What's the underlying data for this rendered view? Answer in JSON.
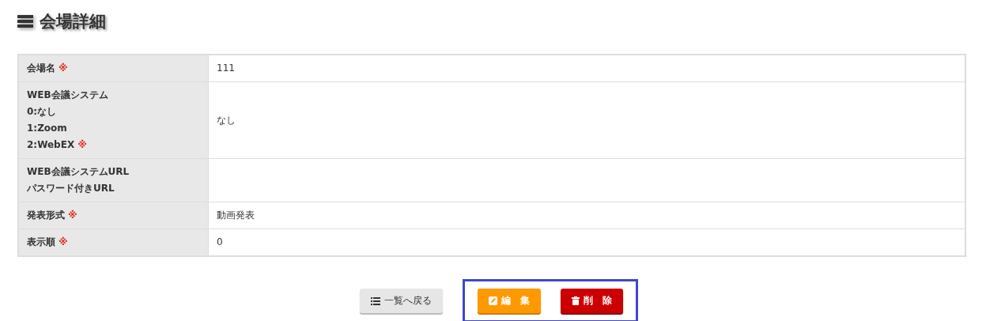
{
  "page": {
    "title": "会場詳細"
  },
  "rows": [
    {
      "label": "会場名",
      "required": true,
      "value": "111"
    },
    {
      "label": "WEB会議システム\n0:なし\n1:Zoom\n2:WebEX",
      "required": true,
      "value": "なし"
    },
    {
      "label": "WEB会議システムURL\nパスワード付きURL",
      "required": false,
      "value": ""
    },
    {
      "label": "発表形式",
      "required": true,
      "value": "動画発表"
    },
    {
      "label": "表示順",
      "required": true,
      "value": "0"
    }
  ],
  "required_mark": "※",
  "buttons": [
    {
      "kind": "back",
      "label": "一覧へ戻る",
      "highlighted": false
    },
    {
      "kind": "edit",
      "label": "編　集",
      "highlighted": true
    },
    {
      "kind": "delete",
      "label": "削　除",
      "highlighted": true
    }
  ]
}
